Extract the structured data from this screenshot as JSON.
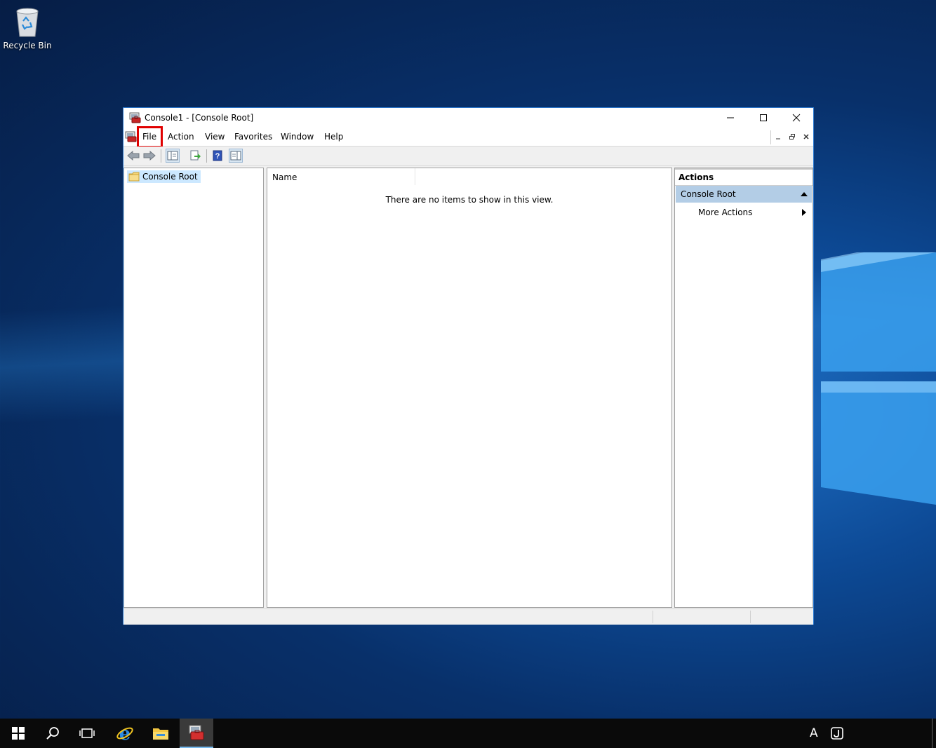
{
  "desktop": {
    "icons": [
      {
        "label": "Recycle Bin",
        "icon": "recycle-bin-icon"
      }
    ]
  },
  "window": {
    "title": "Console1 - [Console Root]",
    "caption_buttons": [
      "minimize",
      "maximize",
      "close"
    ],
    "menu": {
      "items": [
        "File",
        "Action",
        "View",
        "Favorites",
        "Window",
        "Help"
      ],
      "highlighted": "File",
      "highlight_color": "#e00000"
    },
    "toolbar": {
      "buttons": [
        "back-arrow-icon",
        "forward-arrow-icon",
        "show-hide-tree-icon",
        "export-list-icon",
        "help-icon",
        "show-hide-action-pane-icon"
      ]
    },
    "tree": {
      "root_label": "Console Root"
    },
    "list": {
      "column_name": "Name",
      "empty_message": "There are no items to show in this view."
    },
    "actions": {
      "header": "Actions",
      "group_label": "Console Root",
      "more_actions_label": "More Actions"
    }
  },
  "taskbar": {
    "items": [
      "start-icon",
      "search-icon",
      "task-view-icon",
      "internet-explorer-icon",
      "file-explorer-icon",
      "mmc-icon"
    ],
    "active": "mmc-icon",
    "tray_language": "A"
  },
  "colors": {
    "selection": "#cce8ff",
    "actions_group": "#b3cde6",
    "window_border": "#2b79d0",
    "taskbar": "#0a0a0a"
  }
}
